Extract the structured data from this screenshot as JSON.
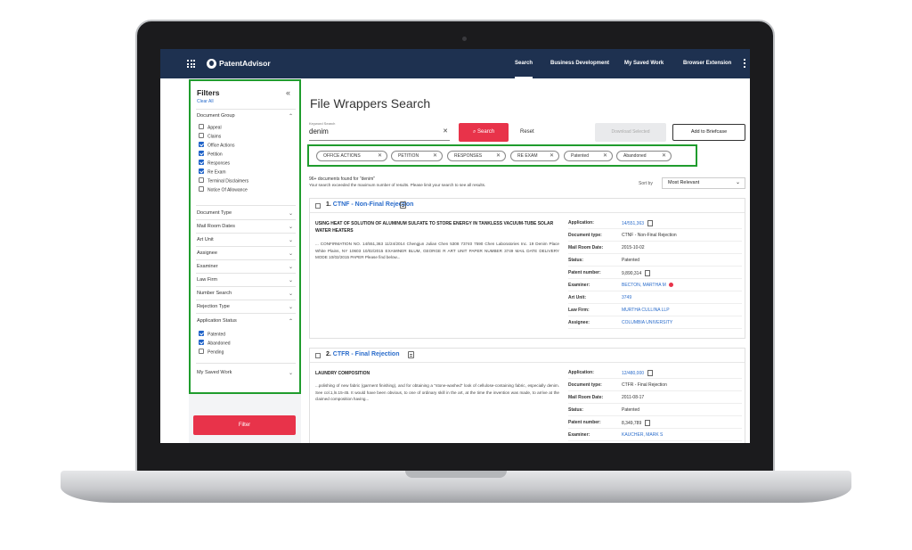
{
  "app": {
    "brand": "PatentAdvisor"
  },
  "nav": {
    "items": [
      "Search",
      "Business Development",
      "My Saved Work",
      "Browser Extension"
    ],
    "active": "Search"
  },
  "filters": {
    "title": "Filters",
    "clear_all": "Clear All",
    "document_group": {
      "label": "Document Group",
      "options": [
        {
          "label": "Appeal",
          "checked": false
        },
        {
          "label": "Claims",
          "checked": false
        },
        {
          "label": "Office Actions",
          "checked": true
        },
        {
          "label": "Petition",
          "checked": true
        },
        {
          "label": "Responses",
          "checked": true
        },
        {
          "label": "Re Exam",
          "checked": true
        },
        {
          "label": "Terminal Disclaimers",
          "checked": false
        },
        {
          "label": "Notice Of Allowance",
          "checked": false
        }
      ]
    },
    "sections": [
      "Document Type",
      "Mail Room Dates",
      "Art Unit",
      "Assignee",
      "Examiner",
      "Law Firm",
      "Number Search",
      "Rejection Type"
    ],
    "application_status": {
      "label": "Application Status",
      "options": [
        {
          "label": "Patented",
          "checked": true
        },
        {
          "label": "Abandoned",
          "checked": true
        },
        {
          "label": "Pending",
          "checked": false
        }
      ]
    },
    "my_saved_work": "My Saved Work",
    "filter_button": "Filter"
  },
  "main": {
    "title": "File Wrappers Search",
    "keyword_label": "Keyword Search",
    "keyword_value": "denim",
    "search_button": "Search",
    "reset": "Reset",
    "download_selected": "Download Selected",
    "add_to_briefcase": "Add to Briefcase",
    "chips": [
      "OFFICE ACTIONS",
      "PETITION",
      "RESPONSES",
      "RE EXAM",
      "Patented",
      "Abandoned"
    ],
    "found_text": "96+ documents found for \"denim\"",
    "warning": "Your search exceeded the maximum number of results. Please limit your search to see all results.",
    "sort_label": "Sort by",
    "sort_value": "Most Relevant"
  },
  "results": [
    {
      "index": "1.",
      "title": "CTNF - Non-Final Rejection",
      "abstract_title": "USING HEAT OF SOLUTION OF ALUMINUM SULFATE TO STORE ENERGY IN TANKLESS VACUUM-TUBE SOLAR WATER HEATERS",
      "abstract": "... CONFIRMATION NO. 14/551,363 11/24/2014 Chengjun Julian Chen 5308 73740 7590 Chen Laboratories Inc. 19 Denim Place White Plains, NY 10603 10/02/2015 EXAMINER BLUM, GEORGE R ART UNIT PAPER NUMBER 3749 MAIL DATE DELIVERY MODE 10/02/2015 PAPER Please find below...",
      "meta": [
        {
          "k": "Application:",
          "v": "14/551,363",
          "link": true,
          "pdf": true
        },
        {
          "k": "Document type:",
          "v": "CTNF - Non-Final Rejection"
        },
        {
          "k": "Mail Room Date:",
          "v": "2015-10-02"
        },
        {
          "k": "Status:",
          "v": "Patented"
        },
        {
          "k": "Patent number:",
          "v": "9,890,314",
          "pdf": true
        },
        {
          "k": "Examiner:",
          "v": "BECTON, MARTHA M",
          "link": true,
          "dot": true
        },
        {
          "k": "Art Unit:",
          "v": "3749",
          "link": true
        },
        {
          "k": "Law Firm:",
          "v": "MURTHA CULLINA LLP",
          "link": true
        },
        {
          "k": "Assignee:",
          "v": "COLUMBIA UNIVERSITY",
          "link": true
        }
      ]
    },
    {
      "index": "2.",
      "title": "CTFR - Final Rejection",
      "abstract_title": "LAUNDRY COMPOSITION",
      "abstract": "...polishing of new fabric (garment finishing), and for obtaining a \"stone-washed\" look of cellulose-containing fabric, especially denim. See col.1,ln.15-45. It would have been obvious, to one of ordinary skill in the art, at the time the invention was made, to arrive at the claimed composition having...",
      "meta": [
        {
          "k": "Application:",
          "v": "12/480,000",
          "link": true,
          "pdf": true
        },
        {
          "k": "Document type:",
          "v": "CTFR - Final Rejection"
        },
        {
          "k": "Mail Room Date:",
          "v": "2011-08-17"
        },
        {
          "k": "Status:",
          "v": "Patented"
        },
        {
          "k": "Patent number:",
          "v": "8,349,789",
          "pdf": true
        },
        {
          "k": "Examiner:",
          "v": "KAUCHER, MARK S",
          "link": true
        }
      ]
    }
  ],
  "colors": {
    "nav_bg": "#1e3150",
    "accent_red": "#e8334a",
    "highlight_green": "#1f9c2d",
    "link_blue": "#2a6ccb"
  }
}
